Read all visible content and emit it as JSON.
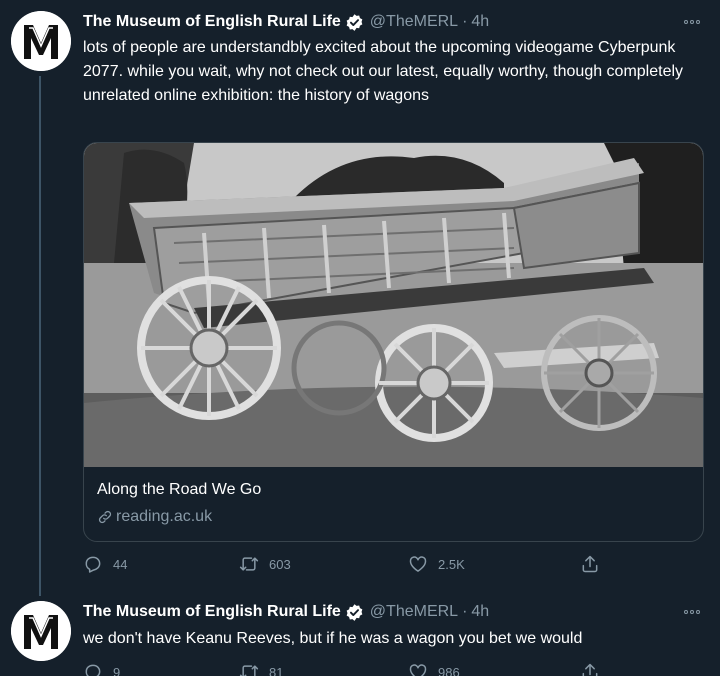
{
  "colors": {
    "background": "#15202b",
    "secondary_text": "#8899a6",
    "verified": "#ffffff",
    "border": "#38444d"
  },
  "tweets": [
    {
      "author": {
        "name": "The Museum of English Rural Life",
        "handle": "@TheMERL",
        "time": "4h",
        "avatar_icon": "merl-logo-icon"
      },
      "text": "lots of people are understandbly excited about the upcoming videogame Cyberpunk 2077. while you wait, why not check out our latest, equally worthy, though completely unrelated online exhibition: the history of wagons",
      "card": {
        "title": "Along the Road We Go",
        "domain": "reading.ac.uk",
        "image_icon": "wagon-photo"
      },
      "stats": {
        "replies": "44",
        "retweets": "603",
        "likes": "2.5K"
      }
    },
    {
      "author": {
        "name": "The Museum of English Rural Life",
        "handle": "@TheMERL",
        "time": "4h",
        "avatar_icon": "merl-logo-icon"
      },
      "text": "we don't have Keanu Reeves, but if he was a wagon you bet we would",
      "stats": {
        "replies": "9",
        "retweets": "81",
        "likes": "986"
      }
    }
  ]
}
